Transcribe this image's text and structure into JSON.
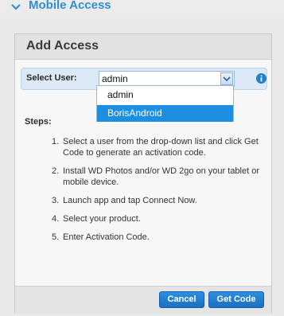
{
  "section": {
    "title": "Mobile Access",
    "icon": "chevron-down-icon"
  },
  "dialog": {
    "title": "Add Access",
    "select_label": "Select User:",
    "selected_user": "admin",
    "options": [
      "admin",
      "BorisAndroid"
    ],
    "highlighted_option": "BorisAndroid",
    "steps_label": "Steps:",
    "steps": [
      {
        "num": "1.",
        "text": "Select a user from the drop-down list and click Get Code to generate an activation code."
      },
      {
        "num": "2.",
        "text": "Install WD Photos and/or WD 2go on your tablet or mobile device."
      },
      {
        "num": "3.",
        "text": "Launch app and tap Connect Now."
      },
      {
        "num": "4.",
        "text": "Select your product."
      },
      {
        "num": "5.",
        "text": "Enter Activation Code."
      }
    ],
    "cancel_label": "Cancel",
    "get_code_label": "Get Code"
  },
  "colors": {
    "accent": "#2d8fd0",
    "button": "#1c7ad0",
    "highlight": "#1e8ee0"
  }
}
